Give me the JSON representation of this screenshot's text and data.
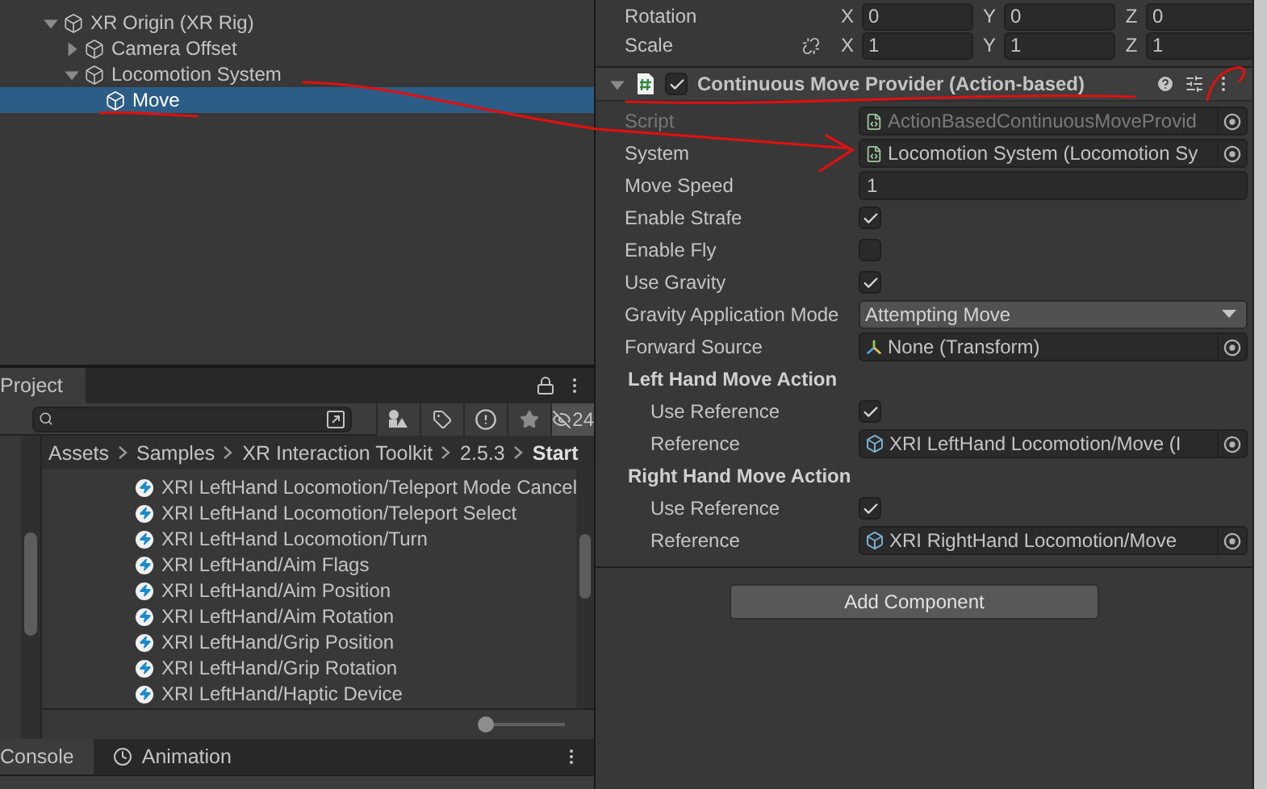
{
  "hierarchy": {
    "items": [
      {
        "label": "XR Origin (XR Rig)",
        "expanded": true,
        "selected": false,
        "children": [
          {
            "label": "Camera Offset",
            "expanded": false,
            "selected": false
          },
          {
            "label": "Locomotion System",
            "expanded": true,
            "selected": false,
            "children": [
              {
                "label": "Move",
                "selected": true
              }
            ]
          }
        ]
      }
    ]
  },
  "inspector": {
    "transform_rows": [
      {
        "label": "Rotation",
        "fields": [
          {
            "axis": "X",
            "value": "0"
          },
          {
            "axis": "Y",
            "value": "0"
          },
          {
            "axis": "Z",
            "value": "0"
          }
        ]
      },
      {
        "label": "Scale",
        "fields": [
          {
            "axis": "X",
            "value": "1"
          },
          {
            "axis": "Y",
            "value": "1"
          },
          {
            "axis": "Z",
            "value": "1"
          }
        ]
      }
    ],
    "component": {
      "title": "Continuous Move Provider (Action-based)",
      "enabled": true,
      "expanded": true,
      "properties": [
        {
          "kind": "script_object",
          "label": "Script",
          "value": "ActionBasedContinuousMoveProvid",
          "disabled": true
        },
        {
          "kind": "script_object",
          "label": "System",
          "value": "Locomotion System (Locomotion Sy",
          "disabled": false
        },
        {
          "kind": "text",
          "label": "Move Speed",
          "value": "1"
        },
        {
          "kind": "checkbox",
          "label": "Enable Strafe",
          "checked": true
        },
        {
          "kind": "checkbox",
          "label": "Enable Fly",
          "checked": false
        },
        {
          "kind": "checkbox",
          "label": "Use Gravity",
          "checked": true
        },
        {
          "kind": "dropdown",
          "label": "Gravity Application Mode",
          "value": "Attempting Move"
        },
        {
          "kind": "transform_object",
          "label": "Forward Source",
          "value": "None (Transform)",
          "disabled": false
        },
        {
          "kind": "group",
          "label": "Left Hand Move Action",
          "children": [
            {
              "kind": "checkbox",
              "label": "Use Reference",
              "checked": true
            },
            {
              "kind": "action_object",
              "label": "Reference",
              "value": "XRI LeftHand Locomotion/Move (I",
              "disabled": false
            }
          ]
        },
        {
          "kind": "group",
          "label": "Right Hand Move Action",
          "children": [
            {
              "kind": "checkbox",
              "label": "Use Reference",
              "checked": true
            },
            {
              "kind": "action_object",
              "label": "Reference",
              "value": "XRI RightHand Locomotion/Move",
              "disabled": false
            }
          ]
        }
      ]
    },
    "add_component_button": "Add Component"
  },
  "project": {
    "tab": "Project",
    "hidden_count": "24",
    "breadcrumb": [
      "Assets",
      "Samples",
      "XR Interaction Toolkit",
      "2.5.3",
      "Start"
    ],
    "assets": [
      "XRI LeftHand Locomotion/Teleport Mode Cancel",
      "XRI LeftHand Locomotion/Teleport Select",
      "XRI LeftHand Locomotion/Turn",
      "XRI LeftHand/Aim Flags",
      "XRI LeftHand/Aim Position",
      "XRI LeftHand/Aim Rotation",
      "XRI LeftHand/Grip Position",
      "XRI LeftHand/Grip Rotation",
      "XRI LeftHand/Haptic Device"
    ],
    "zoom": {
      "level": 0.05
    }
  },
  "bottom_tabs": [
    {
      "label": "Console",
      "selected": true
    },
    {
      "label": "Animation",
      "selected": false
    }
  ]
}
